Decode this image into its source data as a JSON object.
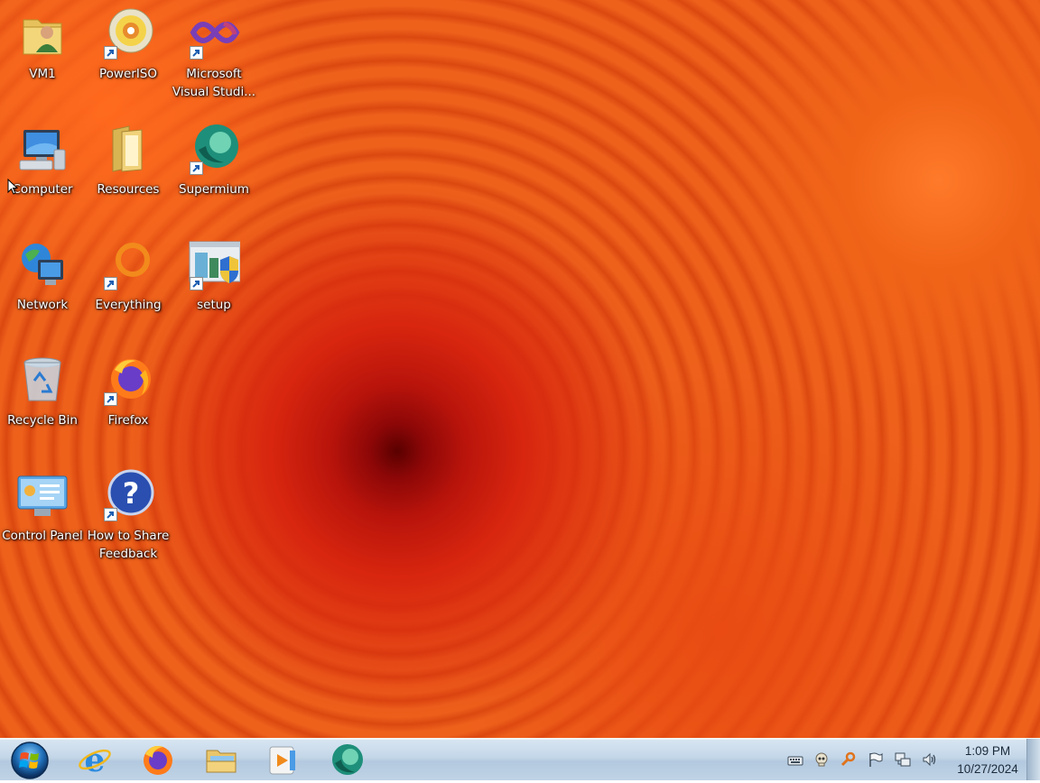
{
  "desktop": {
    "icons": [
      {
        "label": "VM1",
        "icon": "user-folder-icon",
        "shortcut": false
      },
      {
        "label": "PowerISO",
        "icon": "disc-icon",
        "shortcut": true
      },
      {
        "label": "Microsoft Visual Studi...",
        "icon": "visual-studio-icon",
        "shortcut": true
      },
      {
        "label": "Computer",
        "icon": "computer-icon",
        "shortcut": false
      },
      {
        "label": "Resources",
        "icon": "folder-icon",
        "shortcut": false
      },
      {
        "label": "Supermium",
        "icon": "supermium-icon",
        "shortcut": true
      },
      {
        "label": "Network",
        "icon": "network-icon",
        "shortcut": false
      },
      {
        "label": "Everything",
        "icon": "search-ring-icon",
        "shortcut": true
      },
      {
        "label": "setup",
        "icon": "installer-icon",
        "shortcut": true
      },
      {
        "label": "Recycle Bin",
        "icon": "recycle-bin-icon",
        "shortcut": false
      },
      {
        "label": "Firefox",
        "icon": "firefox-icon",
        "shortcut": true
      },
      {
        "label": "Control Panel",
        "icon": "control-panel-icon",
        "shortcut": false
      },
      {
        "label": "How to Share Feedback",
        "icon": "help-icon",
        "shortcut": true
      }
    ]
  },
  "taskbar": {
    "start": "windows-orb-icon",
    "pinned": [
      "internet-explorer-icon",
      "firefox-icon",
      "file-explorer-icon",
      "media-player-icon",
      "supermium-icon"
    ],
    "tray": [
      "keyboard-icon",
      "skull-icon",
      "key-search-icon",
      "action-center-flag-icon",
      "network-status-icon",
      "volume-icon"
    ],
    "clock": {
      "time": "1:09 PM",
      "date": "10/27/2024"
    }
  },
  "colors": {
    "accent": "#1f6fb8",
    "wallpaper": "#ea5514"
  }
}
